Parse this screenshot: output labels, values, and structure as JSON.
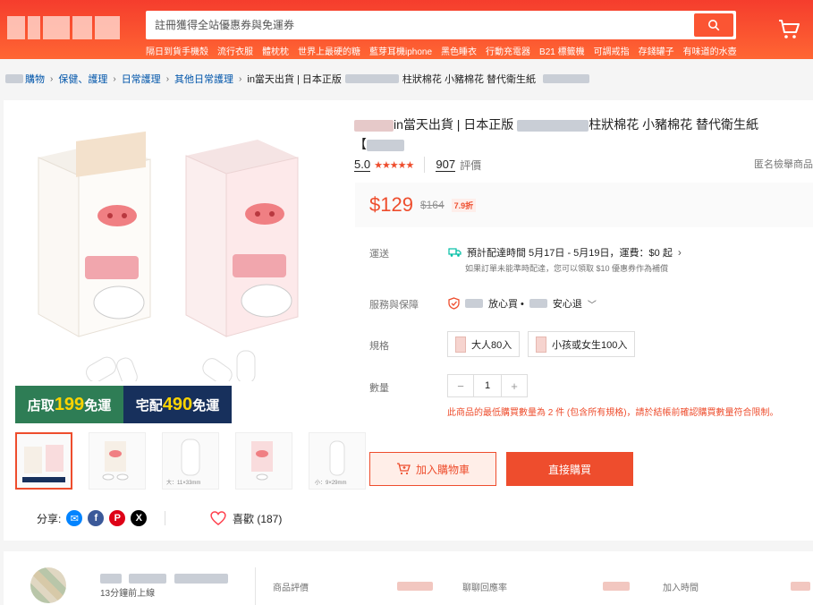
{
  "search": {
    "placeholder": "註冊獲得全站優惠券與免運券"
  },
  "hotwords": [
    "隔日到貨手機殼",
    "流行衣服",
    "體枕枕",
    "世界上最硬的糖",
    "藍芽耳機iphone",
    "黑色睡衣",
    "行動充電器",
    "B21 標籤機",
    "可調戒指",
    "存錢罐子",
    "有味道的水壺"
  ],
  "breadcrumb": {
    "items": [
      "購物",
      "保健、護理",
      "日常護理",
      "其他日常護理"
    ],
    "current": "in當天出貨 | 日本正版",
    "current_tail": "柱狀棉花 小豬棉花 替代衛生紙"
  },
  "product": {
    "title_part1": "in當天出貨 | 日本正版",
    "title_part2": "柱狀棉花 小豬棉花 替代衛生紙",
    "title_tail": "【",
    "rating": "5.0",
    "stars": "★★★★★",
    "reviews_count": "907",
    "reviews_label": "評價",
    "anonymous_report": "匿名檢舉商品",
    "price": "$129",
    "original_price": "$164",
    "discount": "7.9折"
  },
  "promo": {
    "store_pickup_prefix": "店取",
    "store_pickup_amount": "199",
    "store_pickup_suffix": "免運",
    "home_delivery_prefix": "宅配",
    "home_delivery_amount": "490",
    "home_delivery_suffix": "免運"
  },
  "shipping": {
    "label": "運送",
    "estimate": "預計配達時間 5月17日 - 5月19日，運費：$0 起",
    "note": "如果訂單未能準時配達，您可以領取 $10 優惠券作為補償"
  },
  "guarantee": {
    "label": "服務與保障",
    "text1": "放心買 •",
    "text2": "安心退"
  },
  "spec": {
    "label": "規格",
    "options": [
      "大人80入",
      "小孩或女生100入"
    ]
  },
  "quantity": {
    "label": "數量",
    "minus": "−",
    "value": "1",
    "plus": "+"
  },
  "min_purchase_warning": "此商品的最低購買數量為 2 件 (包含所有規格)，請於結帳前確認購買數量符合限制。",
  "buttons": {
    "add_to_cart": "加入購物車",
    "buy_now": "直接購買"
  },
  "share": {
    "label": "分享:",
    "likes_label": "喜歡 (187)"
  },
  "thumbnail_captions": [
    "大：11×33mm",
    "小：9×29mm"
  ],
  "seller": {
    "online": "13分鐘前上線",
    "stat_reviews": "商品評價",
    "stat_response": "聊聊回應率",
    "stat_joined": "加入時間"
  },
  "colors": {
    "brand": "#ee4d2d",
    "header": "#f53d2d",
    "link": "#0055aa",
    "star": "#ee4d2d"
  }
}
